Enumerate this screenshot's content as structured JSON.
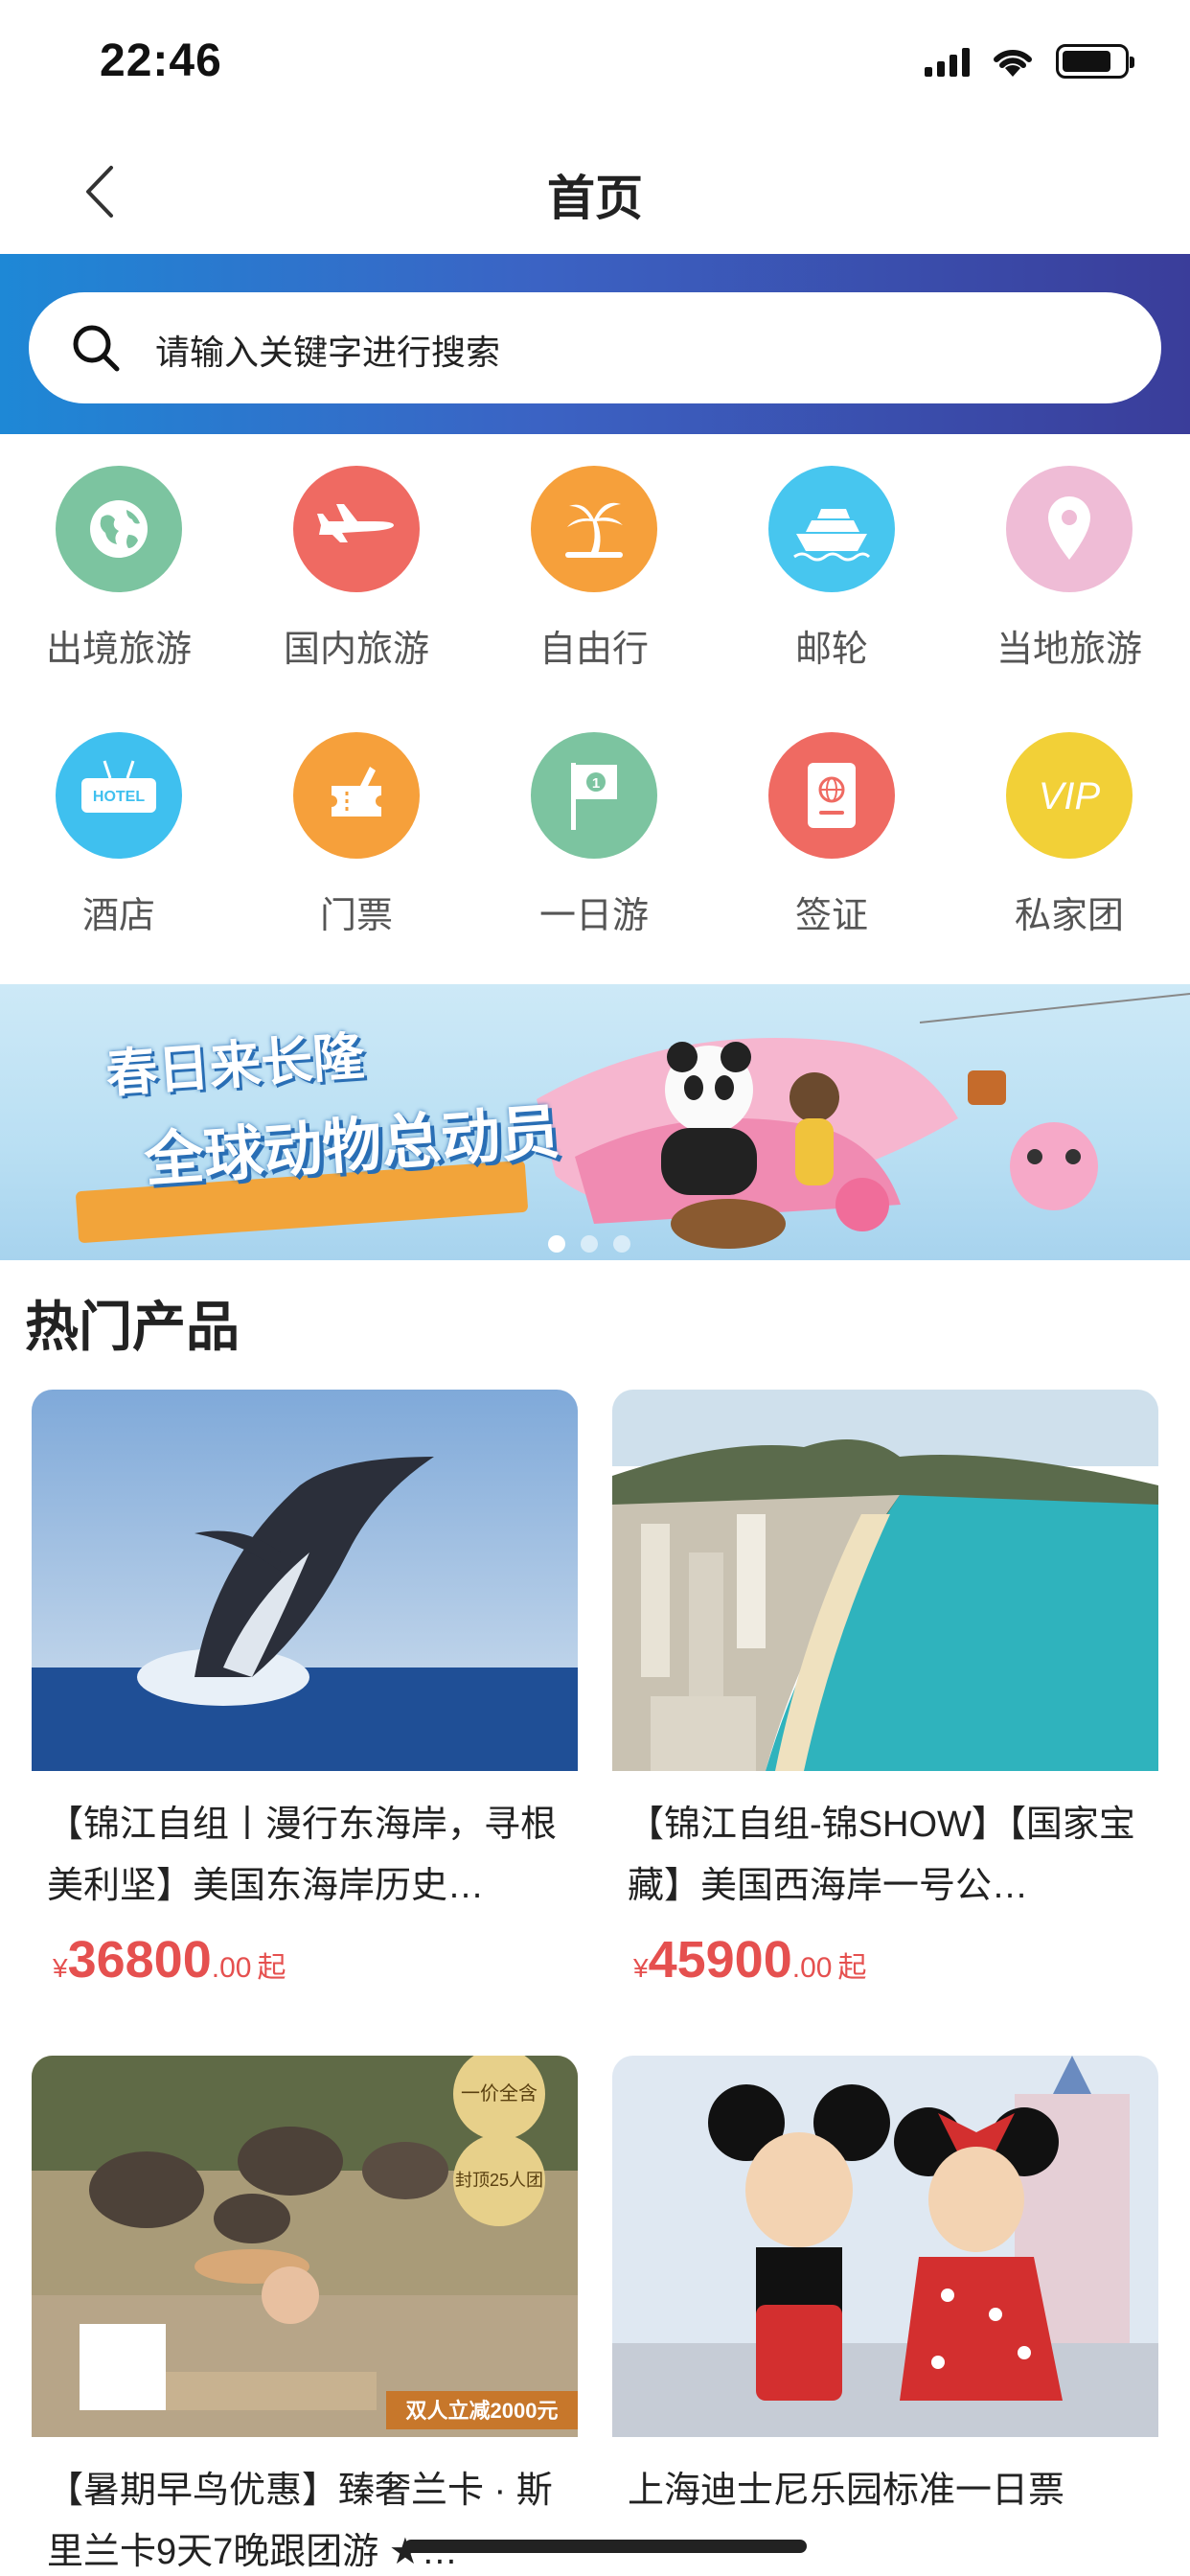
{
  "status_bar": {
    "time": "22:46"
  },
  "nav": {
    "title": "首页"
  },
  "search": {
    "placeholder": "请输入关键字进行搜索"
  },
  "categories": [
    {
      "label": "出境旅游",
      "icon": "globe-icon",
      "color": "#7cc4a0"
    },
    {
      "label": "国内旅游",
      "icon": "airplane-icon",
      "color": "#ef6a62"
    },
    {
      "label": "自由行",
      "icon": "palm-tree-icon",
      "color": "#f6a03b"
    },
    {
      "label": "邮轮",
      "icon": "cruise-ship-icon",
      "color": "#47c6ef"
    },
    {
      "label": "当地旅游",
      "icon": "location-pin-icon",
      "color": "#efbcd6"
    },
    {
      "label": "酒店",
      "icon": "hotel-sign-icon",
      "color": "#3fc0ef",
      "icon_text": "HOTEL"
    },
    {
      "label": "门票",
      "icon": "ticket-icon",
      "color": "#f6a03b"
    },
    {
      "label": "一日游",
      "icon": "flag-icon",
      "color": "#7cc4a0",
      "icon_text": "1"
    },
    {
      "label": "签证",
      "icon": "passport-icon",
      "color": "#ef6a62"
    },
    {
      "label": "私家团",
      "icon": "vip-icon",
      "color": "#f2d037",
      "icon_text": "VIP"
    }
  ],
  "banner": {
    "line1": "春日来长隆",
    "line2": "全球动物总动员",
    "dots": 3,
    "active_dot": 1
  },
  "section": {
    "title": "热门产品"
  },
  "products": [
    {
      "title": "【锦江自组丨漫行东海岸，寻根美利坚】美国东海岸历史…",
      "currency": "¥",
      "price_int": "36800",
      "price_dec": ".00",
      "price_suffix": "起"
    },
    {
      "title": "【锦江自组-锦SHOW】【国家宝藏】美国西海岸一号公…",
      "currency": "¥",
      "price_int": "45900",
      "price_dec": ".00",
      "price_suffix": "起"
    },
    {
      "title": "【暑期早鸟优惠】臻奢兰卡 · 斯里兰卡9天7晚跟团游 ★…",
      "badge1": "一价全含",
      "badge2": "封顶25人团",
      "promo": "双人立减2000元"
    },
    {
      "title": "上海迪士尼乐园标准一日票"
    }
  ]
}
